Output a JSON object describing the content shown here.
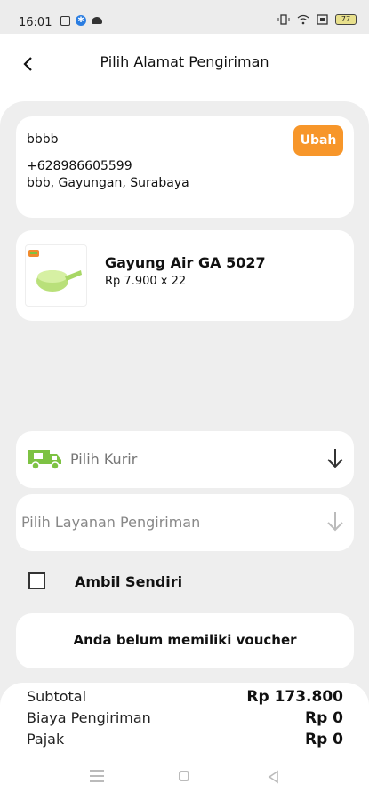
{
  "status_bar": {
    "time": "16:01",
    "battery": "77"
  },
  "header": {
    "title": "Pilih Alamat Pengiriman"
  },
  "address": {
    "name": "bbbb",
    "phone": "+628986605599",
    "line": "bbb, Gayungan, Surabaya",
    "edit_label": "Ubah"
  },
  "product": {
    "name": "Gayung Air GA 5027",
    "price_qty": "Rp 7.900 x 22"
  },
  "courier": {
    "placeholder": "Pilih Kurir"
  },
  "service": {
    "placeholder": "Pilih Layanan Pengiriman"
  },
  "self_pickup": {
    "label": "Ambil Sendiri",
    "checked": false
  },
  "voucher": {
    "text": "Anda belum memiliki voucher"
  },
  "summary": {
    "subtotal_label": "Subtotal",
    "subtotal_value": "Rp 173.800",
    "shipping_label": "Biaya Pengiriman",
    "shipping_value": "Rp 0",
    "tax_label": "Pajak",
    "tax_value": "Rp 0"
  },
  "colors": {
    "accent": "#f7962a",
    "truck": "#7dc243"
  }
}
